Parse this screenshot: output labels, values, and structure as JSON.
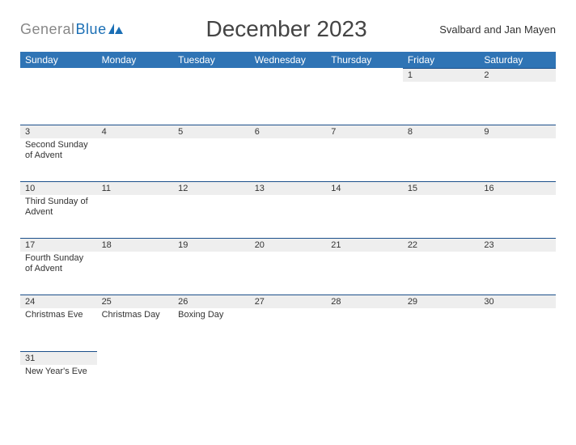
{
  "brand": {
    "part1": "General",
    "part2": "Blue"
  },
  "title": "December 2023",
  "region": "Svalbard and Jan Mayen",
  "day_headers": [
    "Sunday",
    "Monday",
    "Tuesday",
    "Wednesday",
    "Thursday",
    "Friday",
    "Saturday"
  ],
  "weeks": [
    [
      {
        "n": "",
        "e": ""
      },
      {
        "n": "",
        "e": ""
      },
      {
        "n": "",
        "e": ""
      },
      {
        "n": "",
        "e": ""
      },
      {
        "n": "",
        "e": ""
      },
      {
        "n": "1",
        "e": ""
      },
      {
        "n": "2",
        "e": ""
      }
    ],
    [
      {
        "n": "3",
        "e": "Second Sunday of Advent"
      },
      {
        "n": "4",
        "e": ""
      },
      {
        "n": "5",
        "e": ""
      },
      {
        "n": "6",
        "e": ""
      },
      {
        "n": "7",
        "e": ""
      },
      {
        "n": "8",
        "e": ""
      },
      {
        "n": "9",
        "e": ""
      }
    ],
    [
      {
        "n": "10",
        "e": "Third Sunday of Advent"
      },
      {
        "n": "11",
        "e": ""
      },
      {
        "n": "12",
        "e": ""
      },
      {
        "n": "13",
        "e": ""
      },
      {
        "n": "14",
        "e": ""
      },
      {
        "n": "15",
        "e": ""
      },
      {
        "n": "16",
        "e": ""
      }
    ],
    [
      {
        "n": "17",
        "e": "Fourth Sunday of Advent"
      },
      {
        "n": "18",
        "e": ""
      },
      {
        "n": "19",
        "e": ""
      },
      {
        "n": "20",
        "e": ""
      },
      {
        "n": "21",
        "e": ""
      },
      {
        "n": "22",
        "e": ""
      },
      {
        "n": "23",
        "e": ""
      }
    ],
    [
      {
        "n": "24",
        "e": "Christmas Eve"
      },
      {
        "n": "25",
        "e": "Christmas Day"
      },
      {
        "n": "26",
        "e": "Boxing Day"
      },
      {
        "n": "27",
        "e": ""
      },
      {
        "n": "28",
        "e": ""
      },
      {
        "n": "29",
        "e": ""
      },
      {
        "n": "30",
        "e": ""
      }
    ],
    [
      {
        "n": "31",
        "e": "New Year's Eve"
      },
      {
        "n": "",
        "e": ""
      },
      {
        "n": "",
        "e": ""
      },
      {
        "n": "",
        "e": ""
      },
      {
        "n": "",
        "e": ""
      },
      {
        "n": "",
        "e": ""
      },
      {
        "n": "",
        "e": ""
      }
    ]
  ]
}
